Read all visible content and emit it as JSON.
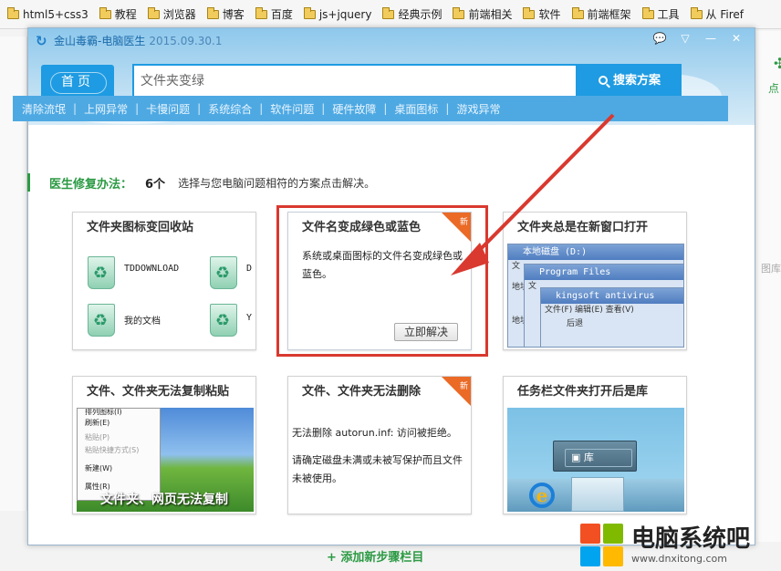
{
  "bookmarks": [
    {
      "label": "html5+css3",
      "icon": "folder-icon"
    },
    {
      "label": "教程",
      "icon": "folder-icon"
    },
    {
      "label": "浏览器",
      "icon": "folder-icon"
    },
    {
      "label": "博客",
      "icon": "folder-icon"
    },
    {
      "label": "百度",
      "icon": "folder-icon"
    },
    {
      "label": "js+jquery",
      "icon": "folder-icon"
    },
    {
      "label": "经典示例",
      "icon": "folder-icon"
    },
    {
      "label": "前端相关",
      "icon": "folder-icon"
    },
    {
      "label": "软件",
      "icon": "folder-icon"
    },
    {
      "label": "前端框架",
      "icon": "folder-icon"
    },
    {
      "label": "工具",
      "icon": "folder-icon"
    },
    {
      "label": "从 Firef",
      "icon": "folder-icon"
    }
  ],
  "background": {
    "right_text_small": "点",
    "right_text_grey": "图库",
    "add_step": "+ 添加新步骤栏目"
  },
  "dialog": {
    "title": "金山毒霸-电脑医生",
    "version": "2015.09.30.1",
    "controls": [
      "💬",
      "▽",
      "—",
      "✕"
    ]
  },
  "search": {
    "home_label": "首页",
    "query": "文件夹变绿",
    "button_label": "搜索方案"
  },
  "categories": [
    "清除流氓",
    "上网异常",
    "卡慢问题",
    "系统综合",
    "软件问题",
    "硬件故障",
    "桌面图标",
    "游戏异常"
  ],
  "section": {
    "label": "医生修复办法：",
    "count": "6个",
    "description": "选择与您电脑问题相符的方案点击解决。"
  },
  "cards": [
    {
      "title": "文件夹图标变回收站",
      "icon_labels": [
        "TDDOWNLOAD",
        "我的文档"
      ],
      "edge_labels": [
        "D",
        "Y"
      ]
    },
    {
      "title": "文件名变成绿色或蓝色",
      "badge": "新",
      "text": "系统或桌面图标的文件名变成绿色或蓝色。",
      "button": "立即解决"
    },
    {
      "title": "文件夹总是在新窗口打开",
      "windows": [
        "本地磁盘 (D:)",
        "Program Files",
        "kingsoft antivirus"
      ],
      "menu": [
        "文",
        "文",
        "文件(F)  编辑(E)  查看(V)"
      ],
      "side_labels": [
        "地址",
        "地址"
      ],
      "back_label": "后退"
    },
    {
      "title": "文件、文件夹无法复制粘贴",
      "menu_items": [
        "排列图标(I)",
        "刷新(E)",
        "粘贴(P)",
        "粘贴快捷方式(S)",
        "新建(W)",
        "属性(R)"
      ],
      "caption": "文件夹、网页无法复制"
    },
    {
      "title": "文件、文件夹无法删除",
      "badge": "新",
      "text_a": "无法删除 autorun.inf: 访问被拒绝。",
      "text_b": "请确定磁盘未满或未被写保护而且文件未被使用。"
    },
    {
      "title": "任务栏文件夹打开后是库",
      "popup_label": "库"
    }
  ],
  "watermark": {
    "title": "电脑系统吧",
    "url": "www.dnxitong.com",
    "colors": [
      "#f25022",
      "#7fba00",
      "#00a4ef",
      "#ffb900"
    ]
  }
}
